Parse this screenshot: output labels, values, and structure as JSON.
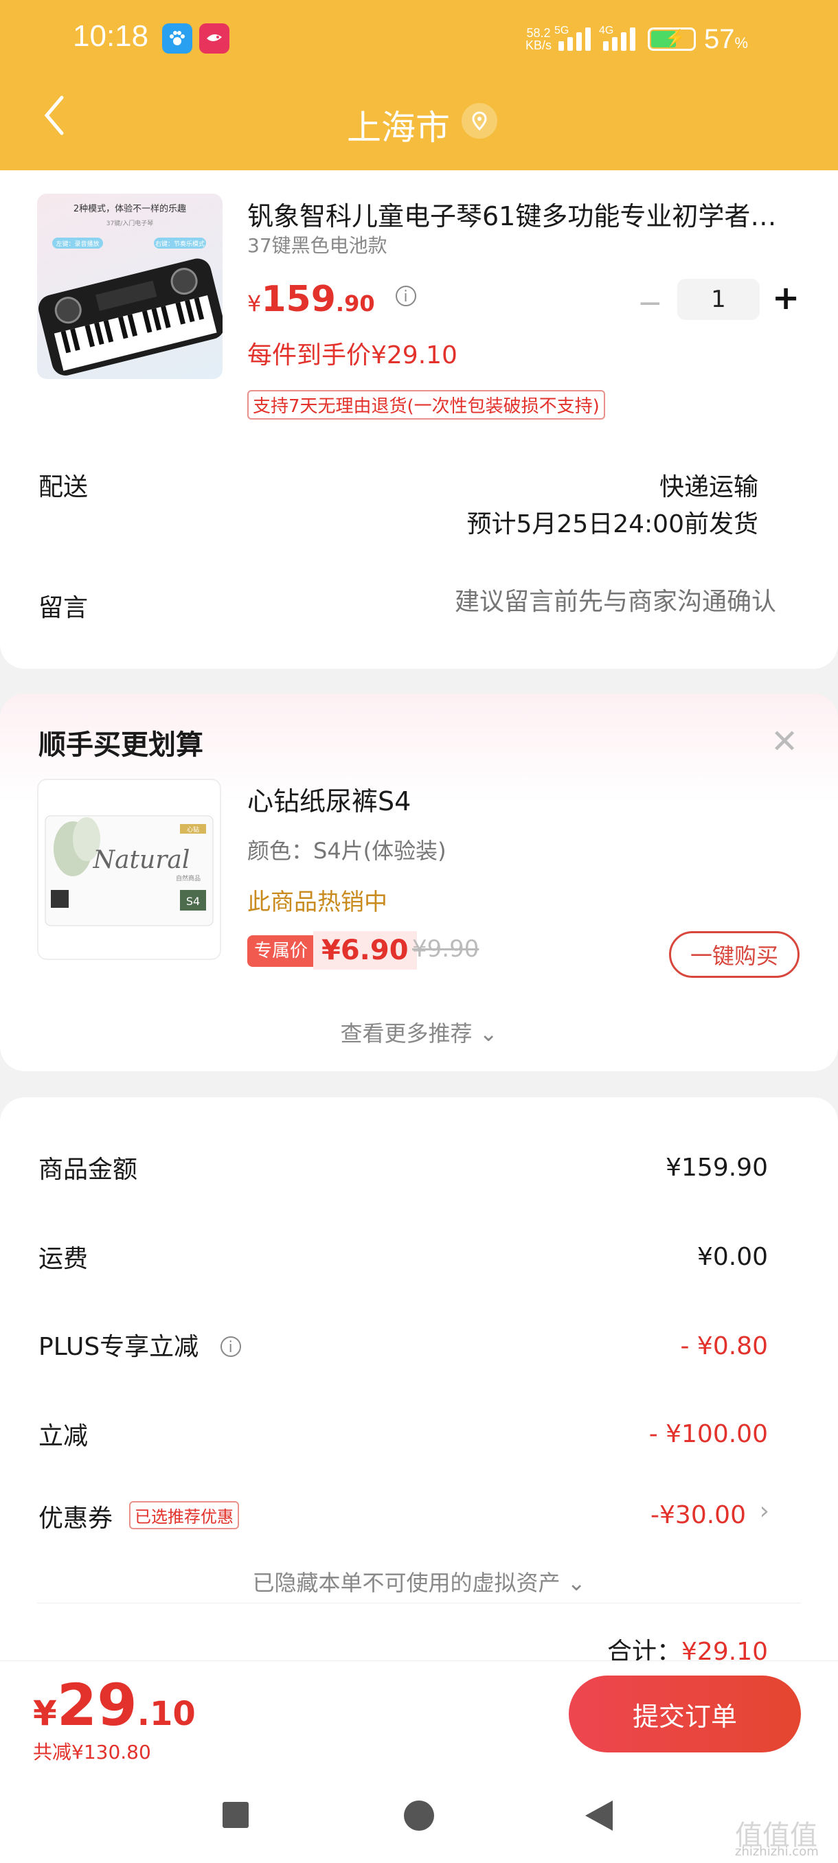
{
  "status_bar": {
    "time": "10:18",
    "apps": [
      "paw-app-icon",
      "fish-app-icon"
    ],
    "net_speed": "58.2",
    "net_unit": "KB/s",
    "signal1": "5G",
    "signal2": "4G",
    "battery": "57",
    "battery_unit": "%"
  },
  "header": {
    "title": "上海市",
    "back_icon": "chevron-left-icon",
    "location_icon": "location-pin-icon",
    "accent": "#f5bc3d"
  },
  "product": {
    "title": "钒象智科儿童电子琴61键多功能专业初学者…",
    "spec": "37键黑色电池款",
    "price_symbol": "¥",
    "price_int": "159",
    "price_dec": ".90",
    "quantity": "1",
    "unit_price": "每件到手价¥29.10",
    "return_tag": "支持7天无理由退货(一次性包装破损不支持)",
    "image_text1": "2种模式，体验不一样的乐趣",
    "image_text2": "37键/入门电子琴",
    "image_text3": "左键：录音播放",
    "image_text4": "右键：节奏乐模式"
  },
  "delivery": {
    "label": "配送",
    "method": "快递运输",
    "eta": "预计5月25日24:00前发货"
  },
  "message": {
    "label": "留言",
    "placeholder": "建议留言前先与商家沟通确认"
  },
  "recommend": {
    "title": "顺手买更划算",
    "name": "心钻纸尿裤S4",
    "color": "颜色：S4片(体验装)",
    "hot": "此商品热销中",
    "exclusive_tag": "专属价",
    "exclusive_price": "¥6.90",
    "original_price": "¥9.90",
    "buy_label": "一键购买",
    "more_label": "查看更多推荐",
    "image_text": "Natural",
    "image_sub": "自然商品",
    "image_brand": "心钻",
    "image_size": "S4"
  },
  "summary": {
    "items": [
      {
        "label": "商品金额",
        "value": "¥159.90"
      },
      {
        "label": "运费",
        "value": "¥0.00"
      },
      {
        "label": "PLUS专享立减",
        "value": "- ¥0.80"
      },
      {
        "label": "立减",
        "value": "- ¥100.00"
      },
      {
        "label": "优惠券",
        "value": "-¥30.00"
      }
    ],
    "coupon_tag": "已选推荐优惠",
    "hidden_assets": "已隐藏本单不可使用的虚拟资产",
    "total_label": "合计：",
    "total_value": "¥29.10"
  },
  "bottom": {
    "symbol": "¥",
    "price_int": "29",
    "price_dec": ".10",
    "saved": "共减¥130.80",
    "submit": "提交订单"
  },
  "nav": [
    "recent-apps-icon",
    "home-icon",
    "back-icon"
  ],
  "watermark": {
    "mark": "值值值",
    "url": "zhizhizhi.com"
  }
}
